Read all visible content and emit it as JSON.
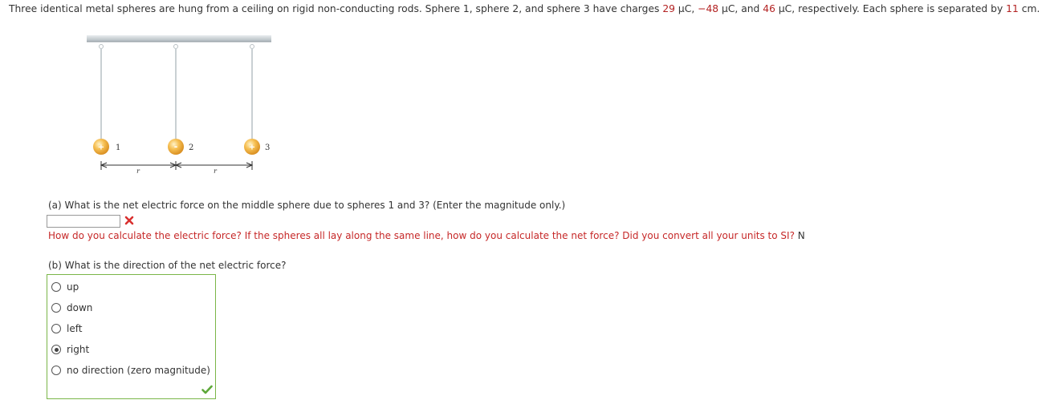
{
  "problem": {
    "text_1": "Three identical metal spheres are hung from a ceiling on rigid non-conducting rods. Sphere 1, sphere 2, and sphere 3 have charges ",
    "q1": "29",
    "text_2": " μC, ",
    "q2": "−48",
    "text_3": " μC, and ",
    "q3": "46",
    "text_4": " μC, respectively. Each sphere is separated by ",
    "separation": "11",
    "text_5": " cm."
  },
  "figure": {
    "sphere1": {
      "sign": "+",
      "label": "1"
    },
    "sphere2": {
      "sign": "-",
      "label": "2"
    },
    "sphere3": {
      "sign": "+",
      "label": "3"
    },
    "distance_label_1": "r",
    "distance_label_2": "r"
  },
  "part_a": {
    "question": "(a) What is the net electric force on the middle sphere due to spheres 1 and 3? (Enter the magnitude only.)",
    "answer_value": "",
    "status": "incorrect",
    "hint": "How do you calculate the electric force? If the spheres all lay along the same line, how do you calculate the net force? Did you convert all your units to SI?",
    "unit": "N"
  },
  "part_b": {
    "question": "(b) What is the direction of the net electric force?",
    "options": [
      "up",
      "down",
      "left",
      "right",
      "no direction (zero magnitude)"
    ],
    "selected": "right",
    "status": "correct"
  },
  "colors": {
    "value_red": "#b32222",
    "hint_red": "#c62828",
    "correct_green": "#7ab648",
    "sphere_orange": "#f2a830"
  }
}
